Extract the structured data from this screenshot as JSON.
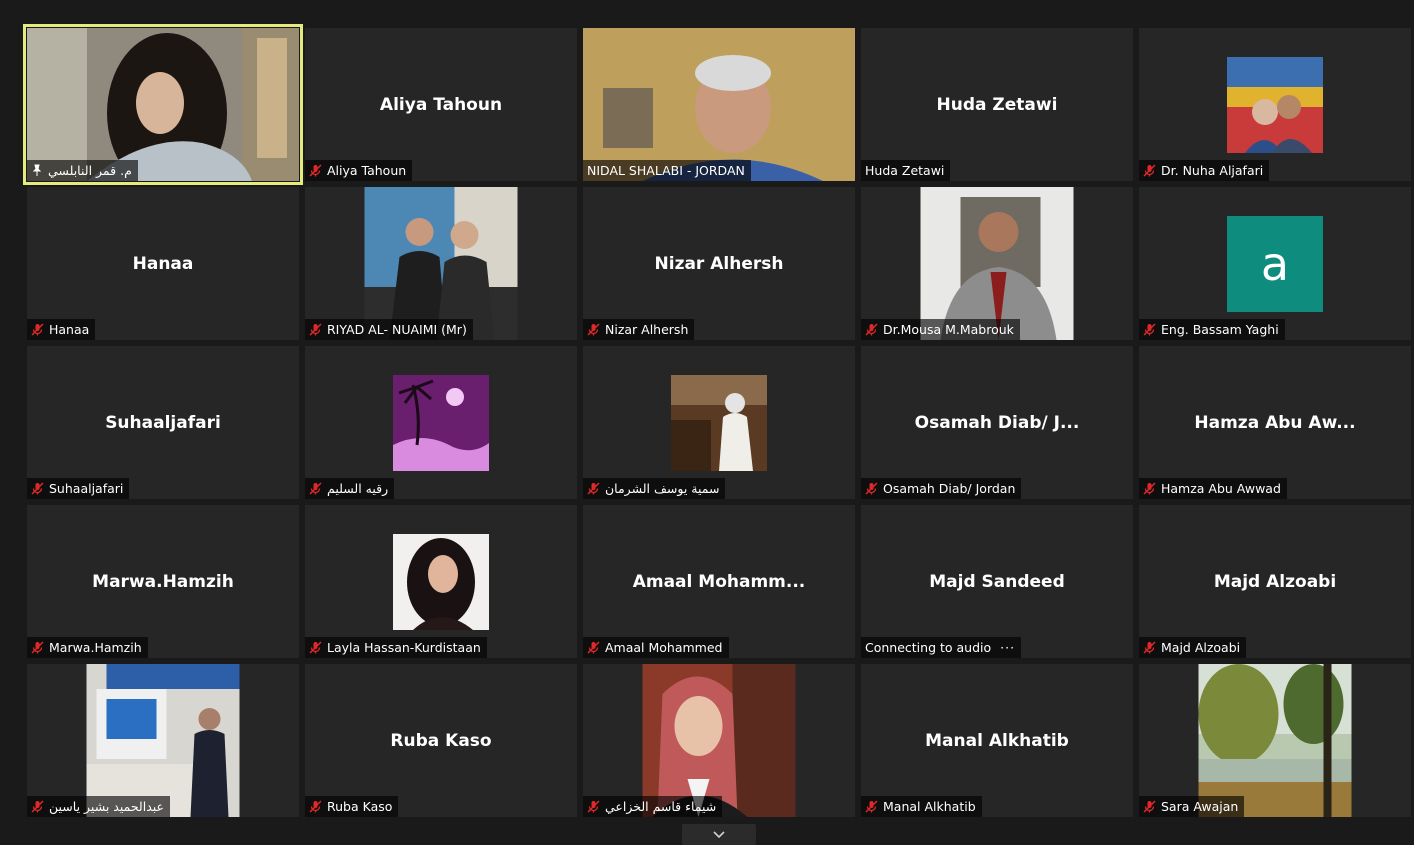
{
  "participants": [
    {
      "name": "م. قمر النابلسي",
      "big": "",
      "mic": "pin",
      "kind": "video",
      "active": true
    },
    {
      "name": "Aliya Tahoun",
      "big": "Aliya Tahoun",
      "mic": "muted",
      "kind": "name"
    },
    {
      "name": "NIDAL SHALABI - JORDAN",
      "big": "",
      "mic": "none",
      "kind": "video"
    },
    {
      "name": "Huda Zetawi",
      "big": "Huda Zetawi",
      "mic": "none",
      "kind": "name"
    },
    {
      "name": "Dr. Nuha Aljafari",
      "big": "",
      "mic": "muted",
      "kind": "avatar-photo"
    },
    {
      "name": "Hanaa",
      "big": "Hanaa",
      "mic": "muted",
      "kind": "name"
    },
    {
      "name": "RIYAD AL- NUAIMI (Mr)",
      "big": "",
      "mic": "muted",
      "kind": "photo-wide"
    },
    {
      "name": "Nizar Alhersh",
      "big": "Nizar Alhersh",
      "mic": "muted",
      "kind": "name"
    },
    {
      "name": "Dr.Mousa M.Mabrouk",
      "big": "",
      "mic": "muted",
      "kind": "photo-wide"
    },
    {
      "name": "Eng. Bassam Yaghi",
      "big": "",
      "mic": "muted",
      "kind": "letter",
      "letter": "a",
      "letter_bg": "#0e8c7e"
    },
    {
      "name": "Suhaaljafari",
      "big": "Suhaaljafari",
      "mic": "muted",
      "kind": "name"
    },
    {
      "name": "رقيه السليم",
      "big": "",
      "mic": "muted",
      "kind": "avatar-photo"
    },
    {
      "name": "سمية يوسف الشرمان",
      "big": "",
      "mic": "muted",
      "kind": "avatar-photo"
    },
    {
      "name": "Osamah Diab/ Jordan",
      "big": "Osamah Diab/ J...",
      "mic": "muted",
      "kind": "name"
    },
    {
      "name": "Hamza Abu Awwad",
      "big": "Hamza Abu Aw...",
      "mic": "muted",
      "kind": "name"
    },
    {
      "name": "Marwa.Hamzih",
      "big": "Marwa.Hamzih",
      "mic": "muted",
      "kind": "name"
    },
    {
      "name": "Layla Hassan-Kurdistaan",
      "big": "",
      "mic": "muted",
      "kind": "avatar-photo"
    },
    {
      "name": "Amaal Mohammed",
      "big": "Amaal  Mohamm...",
      "mic": "muted",
      "kind": "name"
    },
    {
      "name": "Connecting to audio",
      "big": "Majd Sandeed",
      "mic": "none",
      "kind": "name",
      "dots": "···"
    },
    {
      "name": "Majd Alzoabi",
      "big": "Majd Alzoabi",
      "mic": "muted",
      "kind": "name"
    },
    {
      "name": "عبدالحميد بشير ياسين",
      "big": "",
      "mic": "muted",
      "kind": "photo-wide"
    },
    {
      "name": "Ruba Kaso",
      "big": "Ruba Kaso",
      "mic": "muted",
      "kind": "name"
    },
    {
      "name": "شيماء قاسم الخزاعي",
      "big": "",
      "mic": "muted",
      "kind": "photo-wide"
    },
    {
      "name": "Manal Alkhatib",
      "big": "Manal Alkhatib",
      "mic": "muted",
      "kind": "name"
    },
    {
      "name": "Sara Awajan",
      "big": "",
      "mic": "muted",
      "kind": "photo-wide"
    }
  ],
  "colors": {
    "active_border": "#e5ec7c",
    "mic_muted": "#e02828",
    "tile_bg": "#262626"
  },
  "icons": {
    "muted": "mic-muted-icon",
    "pin": "pin-icon",
    "more": "chevron-down-icon"
  }
}
